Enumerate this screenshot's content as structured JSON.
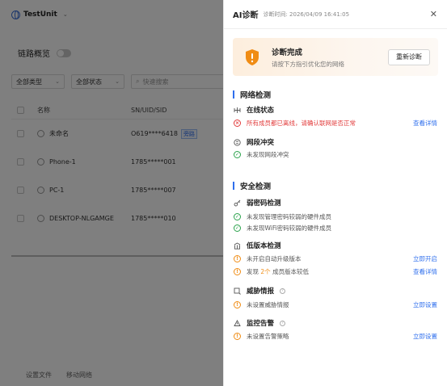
{
  "background": {
    "unit_name": "TestUnit",
    "section_title": "链路概览",
    "filters": {
      "type": "全部类型",
      "status": "全部状态",
      "search_placeholder": "快速搜索"
    },
    "table": {
      "headers": {
        "name": "名称",
        "sn": "SN/UID/SID"
      },
      "rows": [
        {
          "name": "未命名",
          "sn": "O619****6418",
          "tag": "旁路"
        },
        {
          "name": "Phone-1",
          "sn": "1785*****001"
        },
        {
          "name": "PC-1",
          "sn": "1785*****007"
        },
        {
          "name": "DESKTOP-NLGAMGE",
          "sn": "1785*****010"
        }
      ]
    },
    "bottom_tabs": [
      "设置文件",
      "移动网络"
    ]
  },
  "drawer": {
    "title": "AI诊断",
    "time": "诊断时间: 2026/04/09 16:41:05",
    "summary": {
      "title": "诊断完成",
      "subtitle": "请按下方指引优化您的网络",
      "button": "重新诊断"
    },
    "sections": {
      "network": {
        "title": "网络检测",
        "online": {
          "title": "在线状态",
          "line": "所有成员都已离线，请确认联网是否正常",
          "link": "查看详情"
        },
        "conflict": {
          "title": "网段冲突",
          "line": "未发现网段冲突"
        }
      },
      "security": {
        "title": "安全检测",
        "weak_pwd": {
          "title": "弱密码检测",
          "line1": "未发现管理密码较弱的硬件成员",
          "line2": "未发现WiFi密码较弱的硬件成员"
        },
        "low_version": {
          "title": "低版本检测",
          "line1": "未开启自动升级版本",
          "link1": "立即开启",
          "line2_prefix": "发现",
          "line2_count": "2个",
          "line2_suffix": "成员版本较低",
          "link2": "查看详情"
        },
        "threat": {
          "title": "威胁情报",
          "line": "未设置威胁情报",
          "link": "立即设置"
        },
        "alert": {
          "title": "监控告警",
          "line": "未设置告警策略",
          "link": "立即设置"
        }
      }
    }
  },
  "colors": {
    "primary": "#2f6fed",
    "ok": "#2aa24b",
    "error": "#e23c3c",
    "warn": "#f08c14",
    "shield": "#f08c14"
  },
  "icons": {
    "close": "close-icon",
    "shield": "shield-warning-icon",
    "online": "network-topology-icon",
    "conflict": "conflict-icon",
    "key": "key-icon",
    "version": "version-icon",
    "threat": "threat-icon",
    "alert": "alert-icon"
  }
}
